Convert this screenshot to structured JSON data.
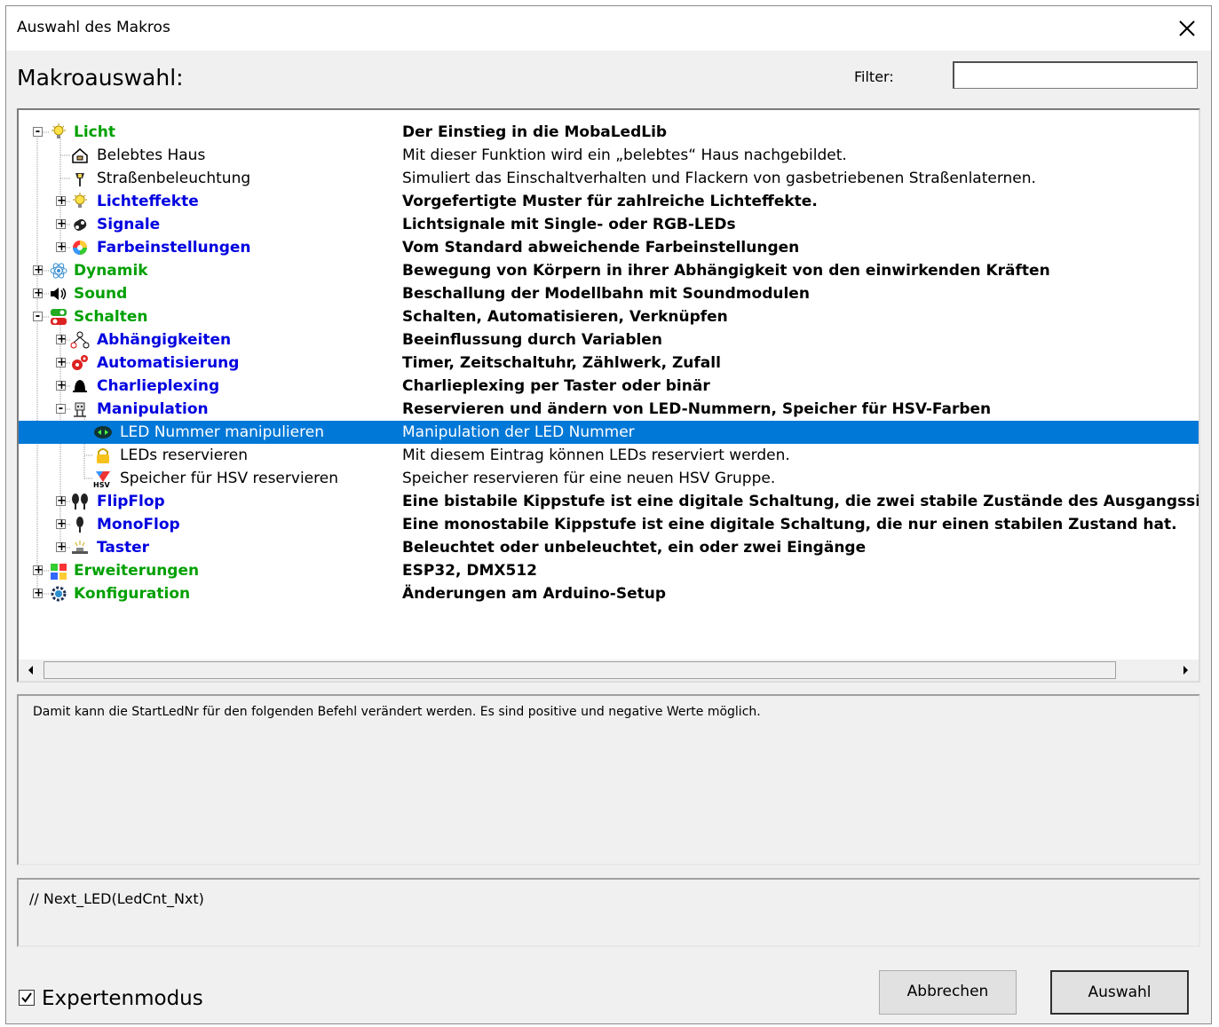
{
  "window": {
    "title": "Auswahl des Makros",
    "close_icon": "close-icon"
  },
  "header": {
    "heading": "Makroauswahl:",
    "filter_label": "Filter:",
    "filter_value": ""
  },
  "tree": {
    "selected_color": "#0078d7",
    "category_color": "#00a000",
    "subcategory_color": "#0000e0",
    "rows": [
      {
        "label": "Licht",
        "desc": "Der Einstieg in die MobaLedLib",
        "kind": "category",
        "expander": "-",
        "icon": "bulb-icon"
      },
      {
        "label": "Belebtes Haus",
        "desc": "Mit dieser Funktion wird ein „belebtes“ Haus nachgebildet.",
        "kind": "leaf",
        "icon": "house-icon"
      },
      {
        "label": "Straßenbeleuchtung",
        "desc": "Simuliert das Einschaltverhalten und Flackern von gasbetriebenen Straßenlaternen.",
        "kind": "leaf",
        "icon": "street-lamp-icon"
      },
      {
        "label": "Lichteffekte",
        "desc": "Vorgefertigte Muster für zahlreiche Lichteffekte.",
        "kind": "subcategory",
        "expander": "+",
        "icon": "bulb-icon"
      },
      {
        "label": "Signale",
        "desc": "Lichtsignale mit Single- oder RGB-LEDs",
        "kind": "subcategory",
        "expander": "+",
        "icon": "signal-icon"
      },
      {
        "label": "Farbeinstellungen",
        "desc": "Vom Standard abweichende Farbeinstellungen",
        "kind": "subcategory",
        "expander": "+",
        "icon": "color-wheel-icon"
      },
      {
        "label": "Dynamik",
        "desc": "Bewegung von Körpern in ihrer Abhängigkeit von den einwirkenden Kräften",
        "kind": "category",
        "expander": "+",
        "icon": "atom-icon"
      },
      {
        "label": "Sound",
        "desc": "Beschallung der Modellbahn mit Soundmodulen",
        "kind": "category",
        "expander": "+",
        "icon": "speaker-icon"
      },
      {
        "label": "Schalten",
        "desc": "Schalten, Automatisieren, Verknüpfen",
        "kind": "category",
        "expander": "-",
        "icon": "switch-icon"
      },
      {
        "label": "Abhängigkeiten",
        "desc": "Beeinflussung durch Variablen",
        "kind": "subcategory",
        "expander": "+",
        "icon": "hierarchy-icon"
      },
      {
        "label": "Automatisierung",
        "desc": "Timer, Zeitschaltuhr, Zählwerk, Zufall",
        "kind": "subcategory",
        "expander": "+",
        "icon": "gears-icon"
      },
      {
        "label": "Charlieplexing",
        "desc": "Charlieplexing per Taster oder binär",
        "kind": "subcategory",
        "expander": "+",
        "icon": "bell-icon"
      },
      {
        "label": "Manipulation",
        "desc": "Reservieren und ändern von LED-Nummern, Speicher für HSV-Farben",
        "kind": "subcategory",
        "expander": "-",
        "icon": "robot-icon"
      },
      {
        "label": "LED Nummer manipulieren",
        "desc": "Manipulation der LED Nummer",
        "kind": "leaf",
        "icon": "arrows-led-icon",
        "selected": true
      },
      {
        "label": "LEDs reservieren",
        "desc": "Mit diesem Eintrag können LEDs reserviert werden.",
        "kind": "leaf",
        "icon": "lock-icon"
      },
      {
        "label": "Speicher für HSV reservieren",
        "desc": "Speicher reservieren für eine neuen HSV Gruppe.",
        "kind": "leaf",
        "icon": "hsv-icon"
      },
      {
        "label": "FlipFlop",
        "desc": "Eine bistabile Kippstufe ist eine digitale Schaltung, die zwei stabile Zustände des Ausgangssignals h",
        "kind": "subcategory",
        "expander": "+",
        "icon": "flipflop-icon"
      },
      {
        "label": "MonoFlop",
        "desc": "Eine monostabile Kippstufe ist eine digitale Schaltung, die nur einen stabilen Zustand hat.",
        "kind": "subcategory",
        "expander": "+",
        "icon": "monoflop-icon"
      },
      {
        "label": "Taster",
        "desc": "Beleuchtet oder unbeleuchtet, ein oder zwei Eingänge",
        "kind": "subcategory",
        "expander": "+",
        "icon": "button-icon"
      },
      {
        "label": "Erweiterungen",
        "desc": "ESP32, DMX512",
        "kind": "category",
        "expander": "+",
        "icon": "puzzle-icon"
      },
      {
        "label": "Konfiguration",
        "desc": "Änderungen am Arduino-Setup",
        "kind": "category",
        "expander": "+",
        "icon": "gear-icon"
      }
    ]
  },
  "description": {
    "text": "Damit kann die StartLedNr für den folgenden Befehl verändert werden. Es sind positive und negative Werte möglich."
  },
  "code": {
    "text": "// Next_LED(LedCnt_Nxt)"
  },
  "footer": {
    "expert_label": "Expertenmodus",
    "expert_checked": true,
    "cancel_label": "Abbrechen",
    "ok_label": "Auswahl"
  }
}
